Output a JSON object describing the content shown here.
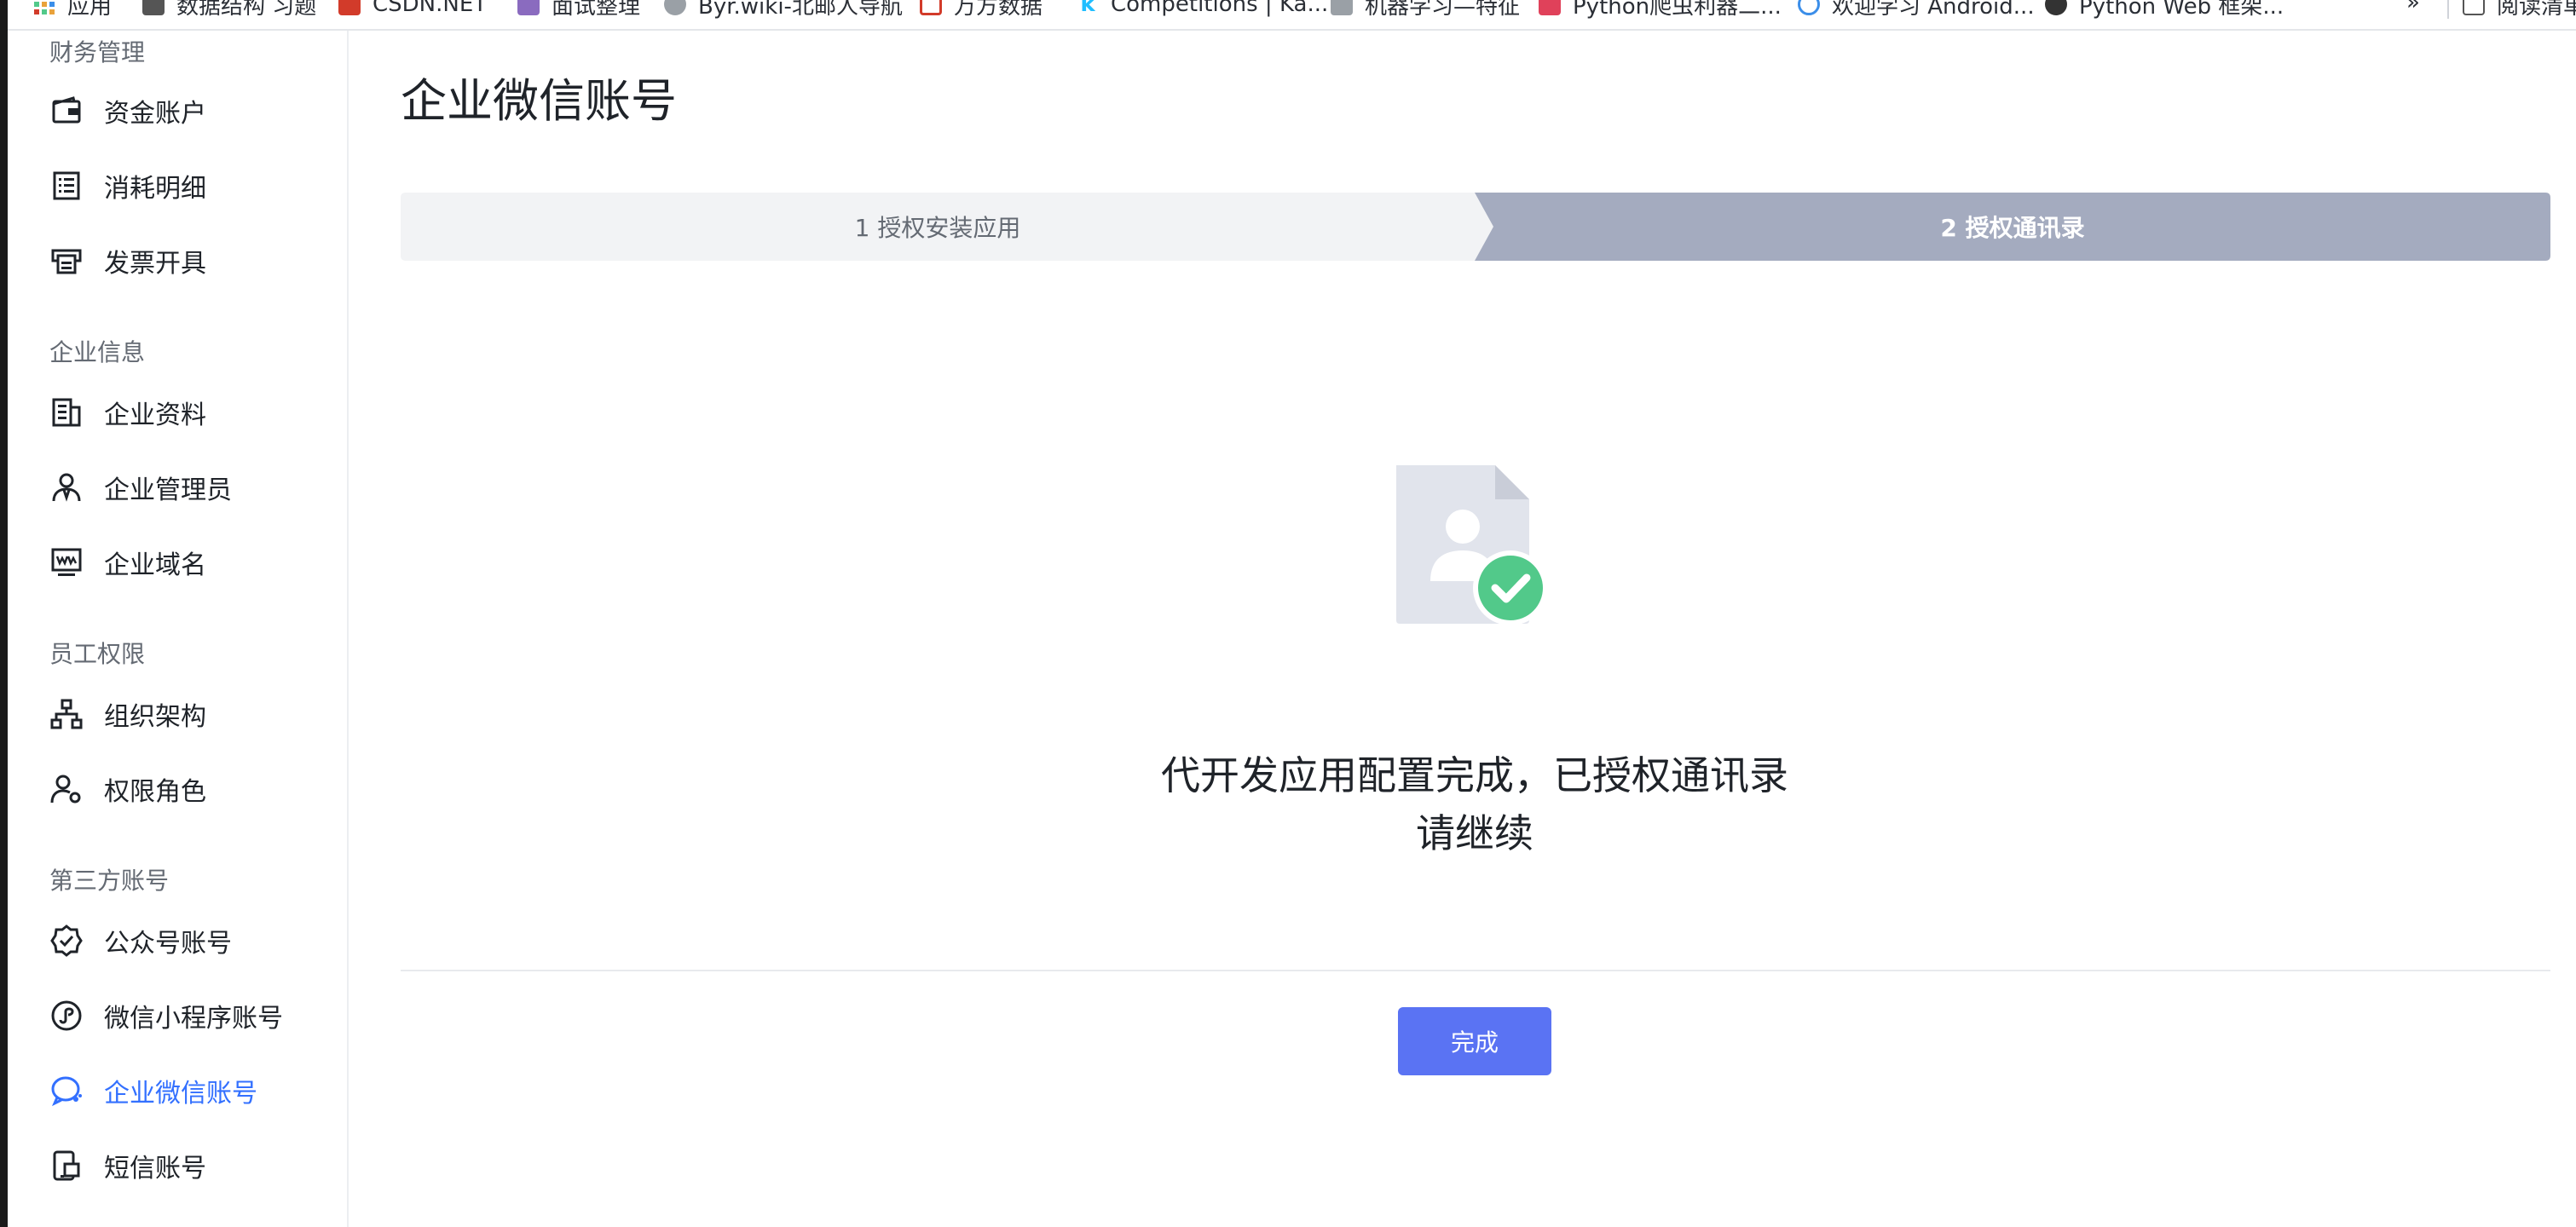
{
  "bookmarks": [
    {
      "label": "应用",
      "icon": "apps-grid-icon",
      "color": "#e9a23b"
    },
    {
      "label": "数据结构 习题",
      "icon": "book-icon",
      "color": "#555555"
    },
    {
      "label": "CSDN.NET",
      "icon": "csdn-logo-icon",
      "color": "#d23b2a"
    },
    {
      "label": "面试整理",
      "icon": "note-icon",
      "color": "#8a6bbf"
    },
    {
      "label": "Byr.wiki-北邮人导航",
      "icon": "globe-icon",
      "color": "#888888"
    },
    {
      "label": "万方数据",
      "icon": "wanfang-logo-icon",
      "color": "#d23b2a"
    },
    {
      "label": "Competitions | Ka...",
      "icon": "kaggle-logo-icon",
      "color": "#20beff"
    },
    {
      "label": "机器学习—特征",
      "icon": "folder-icon",
      "color": "#9aa0a6"
    },
    {
      "label": "Python爬虫利器二...",
      "icon": "pocket-icon",
      "color": "#e0415a"
    },
    {
      "label": "欢迎学习 Android...",
      "icon": "android-icon",
      "color": "#3b8ee9"
    },
    {
      "label": "Python Web 框架...",
      "icon": "dots-icon",
      "color": "#333333"
    }
  ],
  "bookmarks_more": "»",
  "reading_list": "阅读清单",
  "sidebar": {
    "groups": [
      {
        "title": "财务管理",
        "items": [
          {
            "label": "资金账户",
            "icon": "wallet-icon"
          },
          {
            "label": "消耗明细",
            "icon": "list-detail-icon"
          },
          {
            "label": "发票开具",
            "icon": "invoice-printer-icon"
          }
        ]
      },
      {
        "title": "企业信息",
        "items": [
          {
            "label": "企业资料",
            "icon": "building-document-icon"
          },
          {
            "label": "企业管理员",
            "icon": "admin-user-icon"
          },
          {
            "label": "企业域名",
            "icon": "domain-monitor-icon"
          }
        ]
      },
      {
        "title": "员工权限",
        "items": [
          {
            "label": "组织架构",
            "icon": "org-chart-icon"
          },
          {
            "label": "权限角色",
            "icon": "role-user-icon"
          }
        ]
      },
      {
        "title": "第三方账号",
        "items": [
          {
            "label": "公众号账号",
            "icon": "verified-badge-icon"
          },
          {
            "label": "微信小程序账号",
            "icon": "mini-program-icon"
          },
          {
            "label": "企业微信账号",
            "icon": "wecom-chat-icon",
            "active": true
          },
          {
            "label": "短信账号",
            "icon": "sms-phone-icon"
          }
        ]
      }
    ]
  },
  "main": {
    "title": "企业微信账号",
    "steps": [
      {
        "label": "1 授权安装应用",
        "state": "done"
      },
      {
        "label": "2 授权通讯录",
        "state": "current"
      }
    ],
    "illustration_icon": "contact-file-success-icon",
    "message_line1": "代开发应用配置完成，已授权通讯录",
    "message_line2": "请继续",
    "done_button": "完成"
  },
  "colors": {
    "accent": "#3370ff",
    "button": "#5a73f3",
    "step_inactive": "#f2f3f5",
    "step_active": "#a4abbf",
    "success": "#52c98a"
  }
}
